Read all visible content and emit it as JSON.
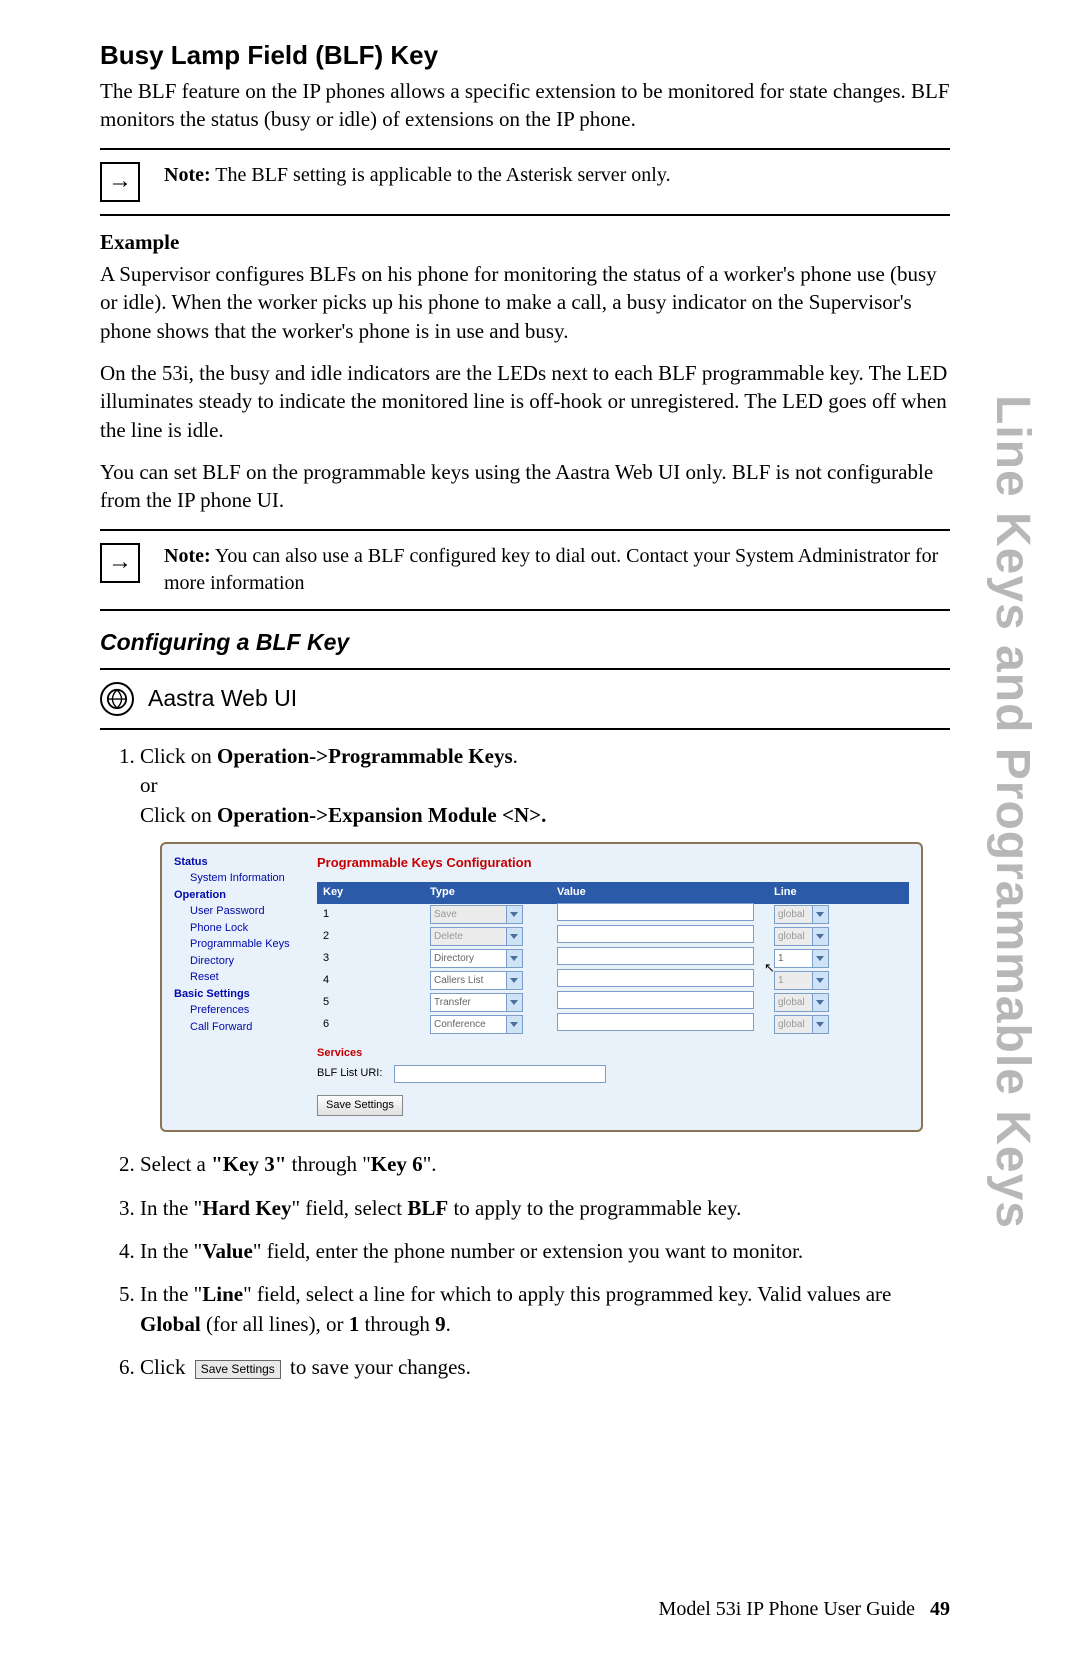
{
  "sideTitle": "Line Keys and Programmable Keys",
  "h2": "Busy Lamp Field (BLF) Key",
  "intro": "The BLF feature on the IP phones allows a specific extension to be monitored for state changes. BLF monitors the status (busy or idle) of extensions on the IP phone.",
  "note1": {
    "label": "Note:",
    "text": " The BLF setting is applicable to the Asterisk server only."
  },
  "exampleHdr": "Example",
  "p2": "A Supervisor configures BLFs on his phone for monitoring the status of a worker's phone use (busy or idle).  When the worker picks up his phone to make a call, a busy indicator on the Supervisor's phone shows that the worker's phone is in use and busy.",
  "p3": "On the 53i, the busy and idle indicators are the LEDs next to each BLF programmable key. The LED illuminates steady to indicate the monitored line is off-hook or unregistered. The LED goes off when the line is idle.",
  "p4": "You can set BLF on the programmable keys using the Aastra Web UI only. BLF is not configurable from the IP phone UI.",
  "note2": {
    "label": "Note:",
    "text": " You can also use a BLF configured key to dial out. Contact your System Administrator for more information"
  },
  "h3": "Configuring a BLF Key",
  "webui": "Aastra Web UI",
  "step1": {
    "a": "Click on ",
    "b": "Operation->Programmable Keys",
    "c": ".",
    "or": "or",
    "d": "Click on ",
    "e": "Operation->Expansion Module <N>."
  },
  "ss": {
    "title": "Programmable Keys Configuration",
    "nav": {
      "status": "Status",
      "sysinfo": "System Information",
      "operation": "Operation",
      "items": [
        "User Password",
        "Phone Lock",
        "Programmable Keys",
        "Directory",
        "Reset"
      ],
      "basic": "Basic Settings",
      "bitems": [
        "Preferences",
        "Call Forward"
      ]
    },
    "head": {
      "key": "Key",
      "type": "Type",
      "value": "Value",
      "line": "Line"
    },
    "rows": [
      {
        "k": "1",
        "type": "Save",
        "dis": true,
        "line": "global",
        "ldis": true
      },
      {
        "k": "2",
        "type": "Delete",
        "dis": true,
        "line": "global",
        "ldis": true
      },
      {
        "k": "3",
        "type": "Directory",
        "dis": false,
        "line": "1",
        "ldis": false
      },
      {
        "k": "4",
        "type": "Callers List",
        "dis": false,
        "line": "1",
        "ldis": true
      },
      {
        "k": "5",
        "type": "Transfer",
        "dis": false,
        "line": "global",
        "ldis": true
      },
      {
        "k": "6",
        "type": "Conference",
        "dis": false,
        "line": "global",
        "ldis": true
      }
    ],
    "services": "Services",
    "blf": "BLF List URI:",
    "save": "Save Settings"
  },
  "step2": {
    "a": "Select a ",
    "b": "\"Key 3\"",
    "c": " through \"",
    "d": "Key 6",
    "e": "\"."
  },
  "step3": {
    "a": "In the \"",
    "b": "Hard Key",
    "c": "\" field, select ",
    "d": "BLF",
    "e": " to apply to the programmable key."
  },
  "step4": {
    "a": "In the \"",
    "b": "Value",
    "c": "\" field, enter the phone number or extension you want to monitor."
  },
  "step5": {
    "a": "In the \"",
    "b": "Line",
    "c": "\" field, select a line for which to apply this programmed key. Valid values are ",
    "d": "Global",
    "e": " (for all lines), or ",
    "f": "1",
    "g": " through ",
    "h": "9",
    "i": "."
  },
  "step6": {
    "a": "Click ",
    "btn": "Save Settings",
    "b": " to save your changes."
  },
  "footer": {
    "a": "Model 53i IP Phone User Guide",
    "b": "49"
  }
}
